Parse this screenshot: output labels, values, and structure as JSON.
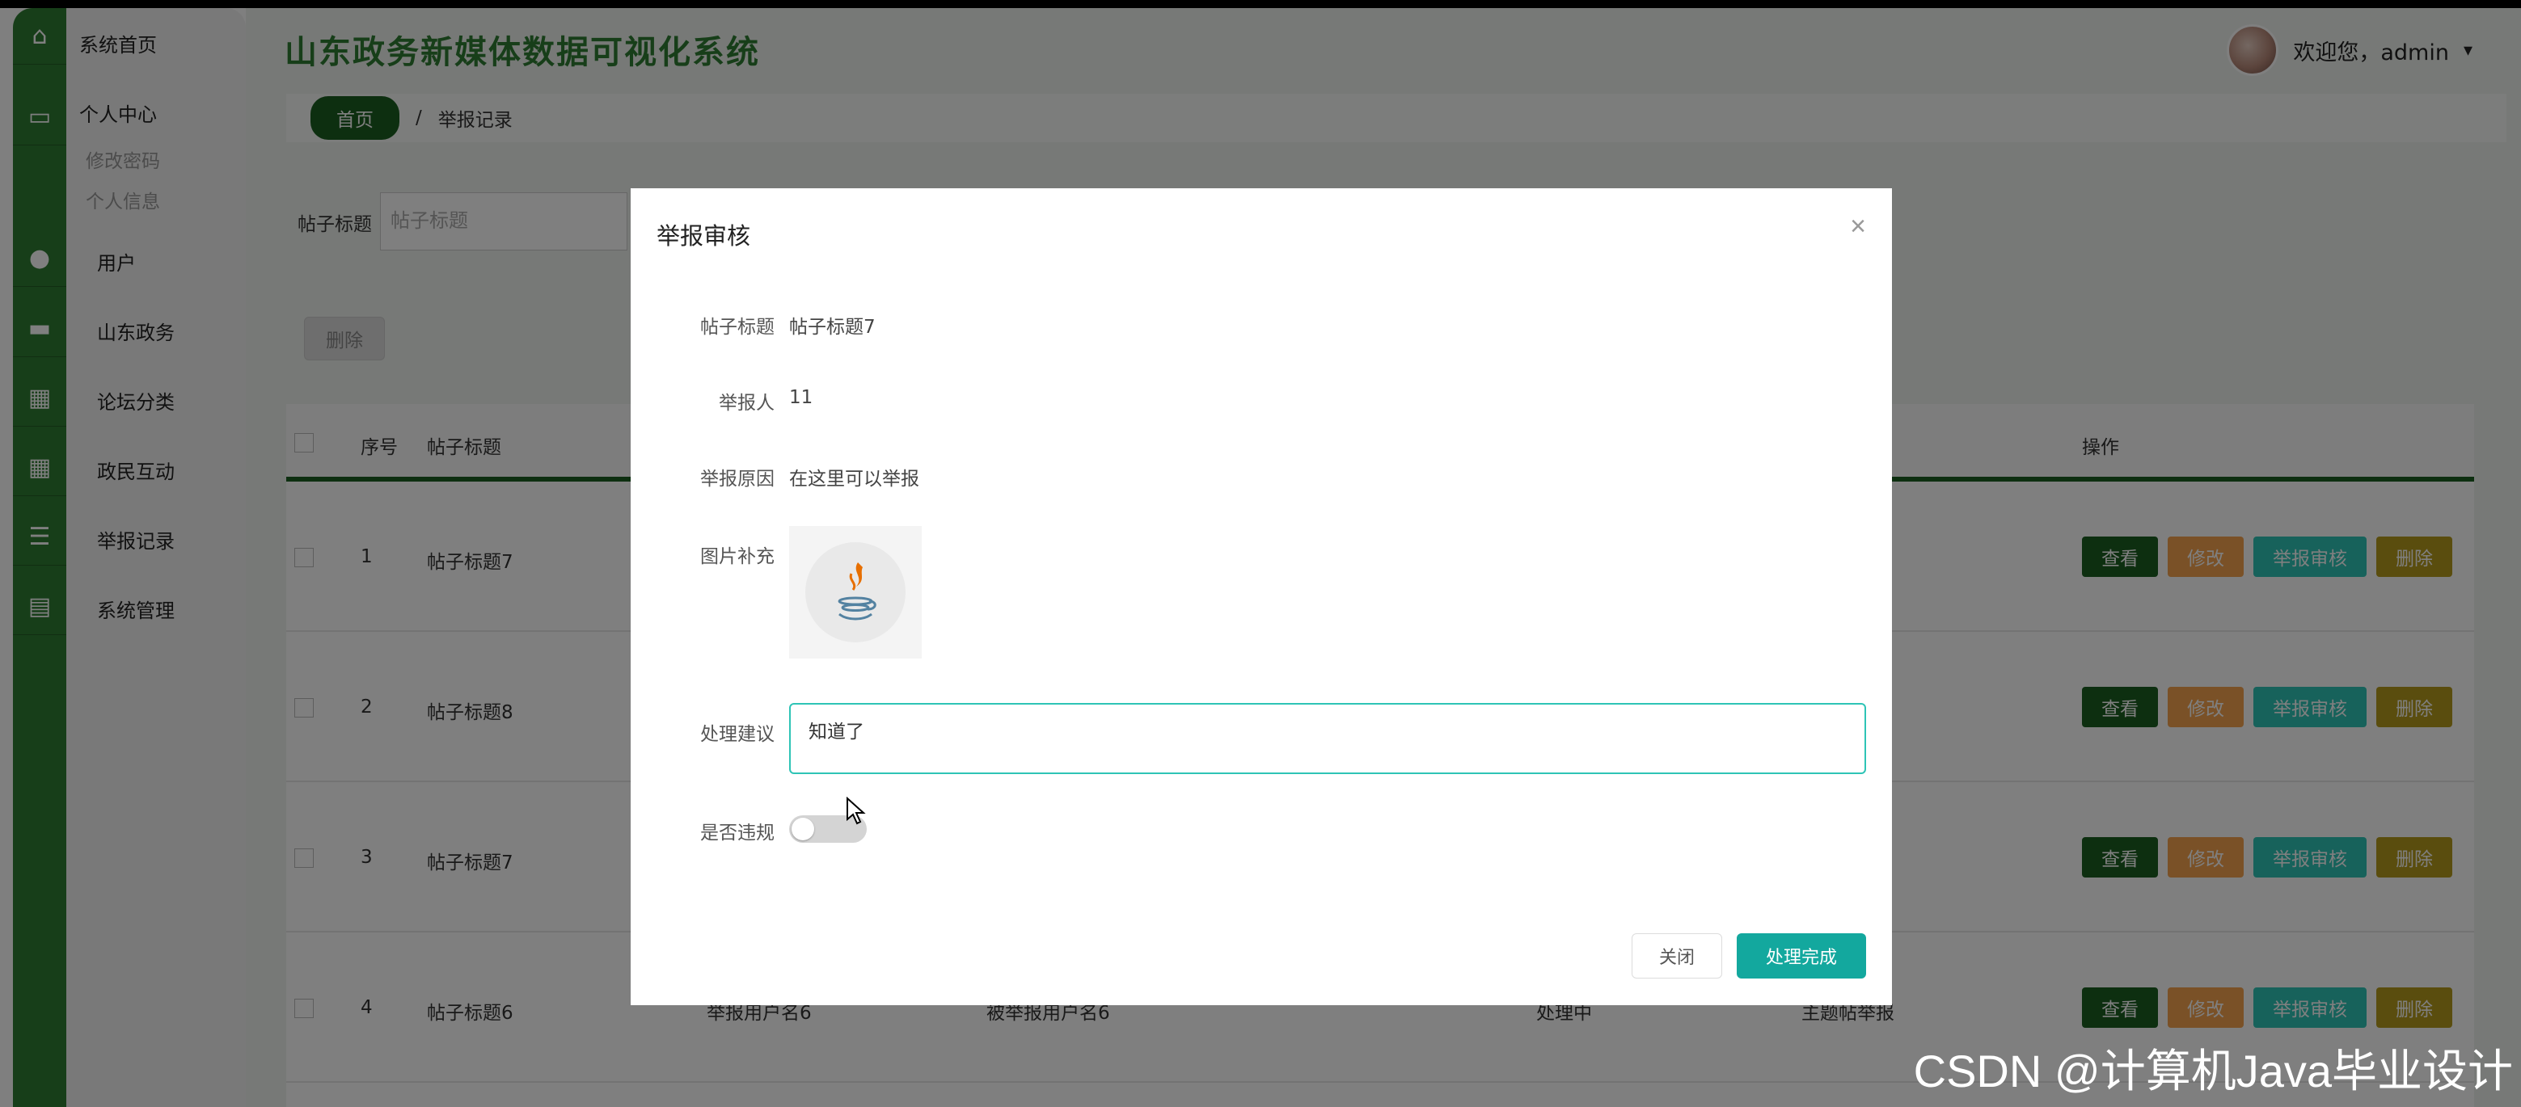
{
  "app": {
    "title": "山东政务新媒体数据可视化系统"
  },
  "user": {
    "greeting": "欢迎您，admin",
    "caret": "▾"
  },
  "rail": {
    "icons": [
      "home-icon",
      "card-icon",
      "bulb-icon",
      "monitor-icon",
      "grid-icon",
      "grid-icon",
      "list-icon",
      "wallet-icon"
    ]
  },
  "sidebar": {
    "items": [
      {
        "label": "系统首页"
      },
      {
        "label": "个人中心"
      },
      {
        "label": "修改密码"
      },
      {
        "label": "个人信息"
      },
      {
        "label": "用户"
      },
      {
        "label": "山东政务"
      },
      {
        "label": "论坛分类"
      },
      {
        "label": "政民互动"
      },
      {
        "label": "举报记录"
      },
      {
        "label": "系统管理"
      }
    ]
  },
  "breadcrumb": {
    "home": "首页",
    "separator": "/",
    "current": "举报记录"
  },
  "search": {
    "label": "帖子标题",
    "placeholder": "帖子标题"
  },
  "toolbar": {
    "delete_label": "删除"
  },
  "table": {
    "headers": {
      "index": "序号",
      "title": "帖子标题",
      "ops": "操作"
    },
    "rows": [
      {
        "index": "1",
        "title": "帖子标题7"
      },
      {
        "index": "2",
        "title": "帖子标题8"
      },
      {
        "index": "3",
        "title": "帖子标题7"
      },
      {
        "index": "4",
        "title": "帖子标题6",
        "reporter": "举报用户名6",
        "reported": "被举报用户名6",
        "status": "处理中",
        "type": "主题帖举报"
      }
    ],
    "ops": {
      "view": "查看",
      "edit": "修改",
      "audit": "举报审核",
      "delete": "删除"
    }
  },
  "modal": {
    "title": "举报审核",
    "close_icon": "×",
    "fields": {
      "post_title_label": "帖子标题",
      "post_title_value": "帖子标题7",
      "reporter_label": "举报人",
      "reporter_value": "11",
      "reason_label": "举报原因",
      "reason_value": "在这里可以举报",
      "image_label": "图片补充",
      "suggestion_label": "处理建议",
      "suggestion_value": "知道了",
      "violation_label": "是否违规",
      "violation_on": false
    },
    "buttons": {
      "close": "关闭",
      "done": "处理完成"
    }
  },
  "colors": {
    "primary": "#1b5e20",
    "accent": "#13a89e",
    "edit": "#f5a34e",
    "audit": "#2ec4b6",
    "delete": "#b59a1d"
  },
  "watermark": "CSDN @计算机Java毕业设计"
}
